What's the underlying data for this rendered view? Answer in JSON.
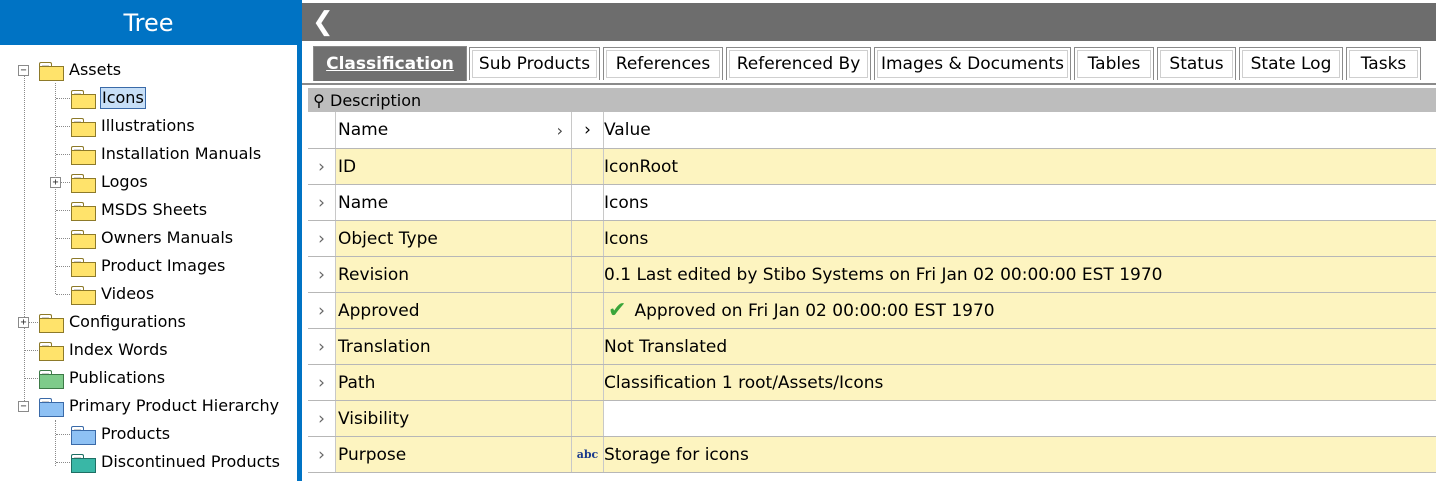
{
  "tree": {
    "title": "Tree",
    "nodes": [
      {
        "label": "Assets",
        "expander": "−",
        "color": "yellow"
      },
      {
        "label": "Icons",
        "color": "yellow",
        "selected": true
      },
      {
        "label": "Illustrations",
        "color": "yellow"
      },
      {
        "label": "Installation Manuals",
        "color": "yellow"
      },
      {
        "label": "Logos",
        "expander": "+",
        "color": "yellow"
      },
      {
        "label": "MSDS Sheets",
        "color": "yellow"
      },
      {
        "label": "Owners Manuals",
        "color": "yellow"
      },
      {
        "label": "Product Images",
        "color": "yellow"
      },
      {
        "label": "Videos",
        "color": "yellow"
      },
      {
        "label": "Configurations",
        "expander": "+",
        "color": "yellow"
      },
      {
        "label": "Index Words",
        "color": "yellow"
      },
      {
        "label": "Publications",
        "color": "green"
      },
      {
        "label": "Primary Product Hierarchy",
        "expander": "−",
        "color": "blue"
      },
      {
        "label": "Products",
        "color": "blue"
      },
      {
        "label": "Discontinued Products",
        "color": "teal"
      }
    ]
  },
  "toolbar": {
    "back_icon": "chevron-left-icon"
  },
  "tabs": [
    "Classification",
    "Sub Products",
    "References",
    "Referenced By",
    "Images & Documents",
    "Tables",
    "Status",
    "State Log",
    "Tasks"
  ],
  "grid": {
    "section_label": "Description",
    "headers": {
      "name": "Name",
      "value": "Value"
    },
    "rows": [
      {
        "name": "ID",
        "value": "IconRoot"
      },
      {
        "name": "Name",
        "value": "Icons"
      },
      {
        "name": "Object Type",
        "value": "Icons"
      },
      {
        "name": "Revision",
        "value": "0.1 Last edited by Stibo Systems on Fri Jan 02 00:00:00 EST 1970"
      },
      {
        "name": "Approved",
        "value": "Approved on Fri Jan 02 00:00:00 EST 1970"
      },
      {
        "name": "Translation",
        "value": "Not Translated"
      },
      {
        "name": "Path",
        "value": "Classification 1 root/Assets/Icons"
      },
      {
        "name": "Visibility",
        "value": ""
      },
      {
        "name": "Purpose",
        "value": "Storage for icons",
        "type_badge": "abc"
      }
    ]
  },
  "colors": {
    "accent": "#0073c4",
    "row_highlight": "#fdf4c0",
    "active_tab": "#707070"
  }
}
